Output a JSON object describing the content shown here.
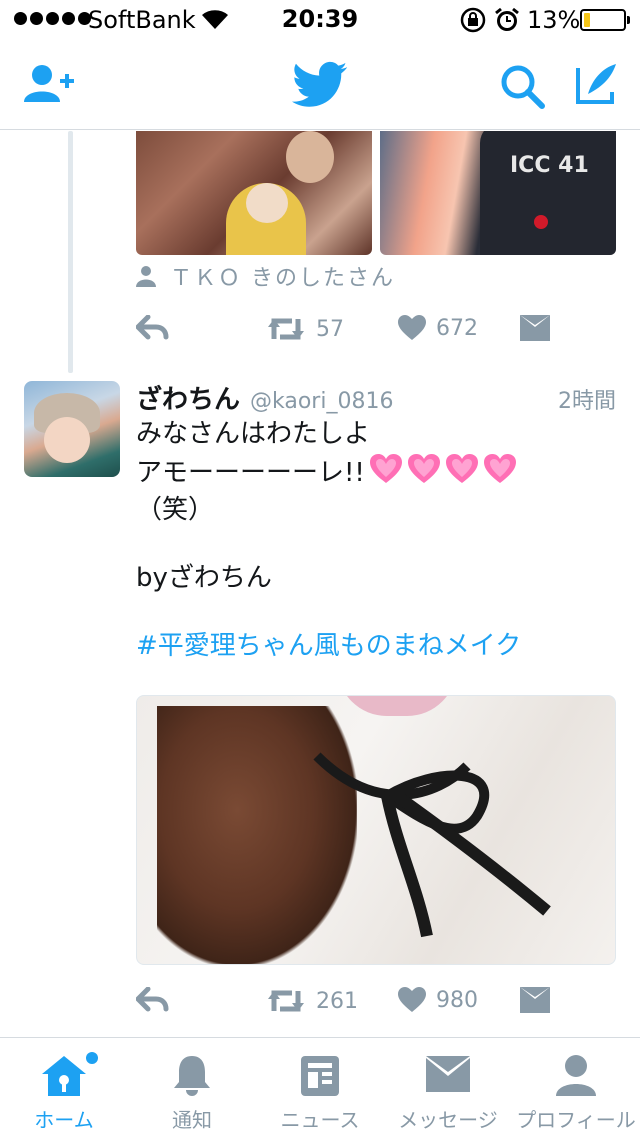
{
  "status_bar": {
    "carrier": "SoftBank",
    "time": "20:39",
    "battery_percent": "13%",
    "battery_level": 0.13
  },
  "nav_bar": {
    "icons": [
      "add-user-icon",
      "twitter-bird-icon",
      "search-icon",
      "compose-icon"
    ]
  },
  "colors": {
    "accent": "#1da1f2",
    "muted": "#8899a6",
    "divider": "#d6dbe0"
  },
  "prev_tweet": {
    "tagged_user": "ＴＫＯ きのしたさん",
    "retweets": "57",
    "likes": "672"
  },
  "tweet": {
    "name": "ざわちん",
    "handle": "@kaori_0816",
    "time": "2時間",
    "lines": [
      "みなさんはわたしよ",
      "アモーーーーーレ!!",
      "（笑）",
      "byざわちん"
    ],
    "hashtag": "#平愛理ちゃん風ものまねメイク",
    "retweets": "261",
    "likes": "980"
  },
  "tab_bar": {
    "tabs": [
      {
        "label": "ホーム",
        "icon": "home-icon",
        "active": true
      },
      {
        "label": "通知",
        "icon": "bell-icon",
        "active": false
      },
      {
        "label": "ニュース",
        "icon": "news-icon",
        "active": false
      },
      {
        "label": "メッセージ",
        "icon": "envelope-icon",
        "active": false
      },
      {
        "label": "プロフィール",
        "icon": "profile-icon",
        "active": false
      }
    ]
  }
}
